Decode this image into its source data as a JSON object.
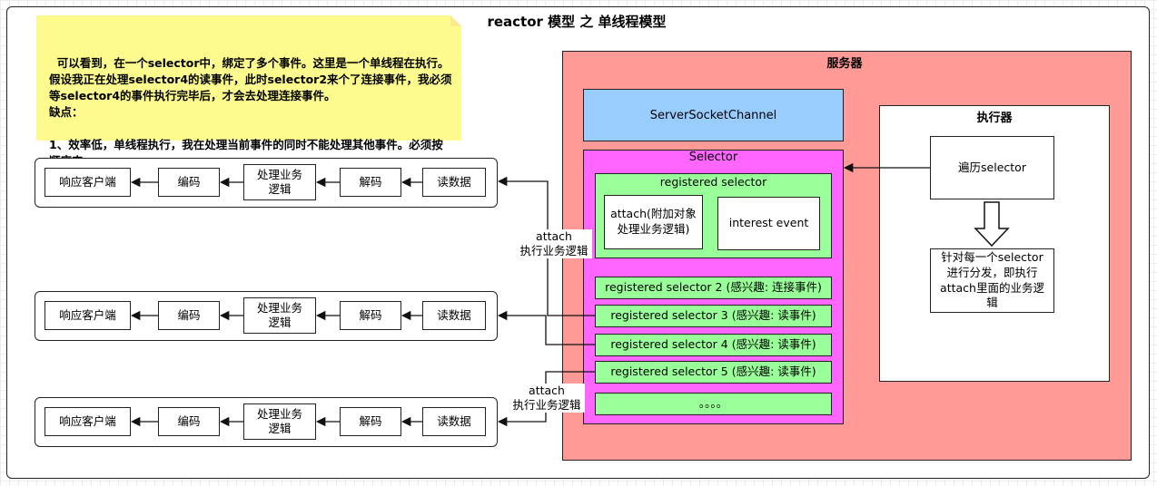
{
  "title": "reactor 模型 之 单线程模型",
  "note": {
    "text": "可以看到，在一个selector中，绑定了多个事件。这里是一个单线程在执行。假设我正在处理selector4的读事件，此时selector2来个了连接事件，我必须等selector4的事件执行完毕后，才会去处理连接事件。\n缺点：\n\n1、效率低，单线程执行，我在处理当前事件的同时不能处理其他事件。必须按顺序来。"
  },
  "server": {
    "title": "服务器",
    "server_socket_channel": "ServerSocketChannel",
    "selector": {
      "title": "Selector",
      "registered_group": {
        "title": "registered selector",
        "attach": "attach(附加对象处理业务逻辑)",
        "interest": "interest event"
      },
      "items": [
        "registered selector 2 (感兴趣: 连接事件)",
        "registered selector 3 (感兴趣: 读事件)",
        "registered selector 4 (感兴趣: 读事件)",
        "registered selector 5 (感兴趣: 读事件)",
        "。。。。"
      ]
    },
    "executor": {
      "title": "执行器",
      "traverse": "遍历selector",
      "dispatch": "针对每一个selector进行分发，即执行attach里面的业务逻辑"
    }
  },
  "pipelines": [
    {
      "steps": [
        "响应客户端",
        "编码",
        "处理业务逻辑",
        "解码",
        "读数据"
      ]
    },
    {
      "steps": [
        "响应客户端",
        "编码",
        "处理业务逻辑",
        "解码",
        "读数据"
      ]
    },
    {
      "steps": [
        "响应客户端",
        "编码",
        "处理业务逻辑",
        "解码",
        "读数据"
      ]
    }
  ],
  "edge_labels": {
    "upper": "attach\n执行业务逻辑",
    "lower": "attach\n执行业务逻辑"
  },
  "colors": {
    "note": "#fdfb8d",
    "server": "#ff9a96",
    "server_socket_channel": "#99ccff",
    "selector": "#ff66ff",
    "registered": "#99ff99"
  }
}
